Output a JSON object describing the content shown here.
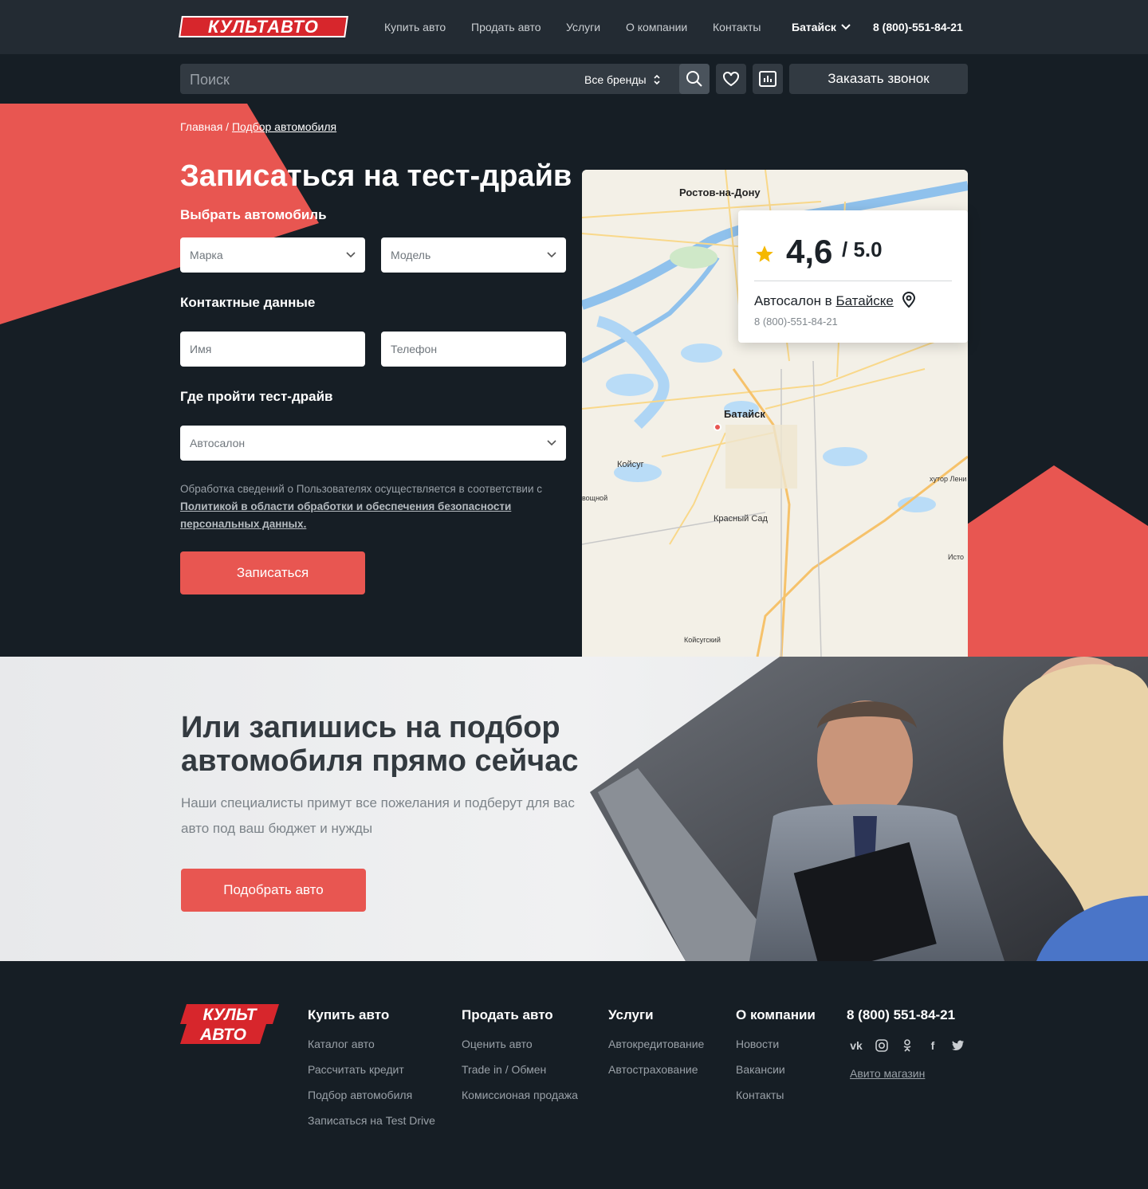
{
  "header": {
    "logo": "КУЛЬТАВТО",
    "nav": [
      "Купить авто",
      "Продать авто",
      "Услуги",
      "О компании",
      "Контакты"
    ],
    "city": "Батайск",
    "phone": "8 (800)-551-84-21"
  },
  "search": {
    "placeholder": "Поиск",
    "brands": "Все бренды",
    "callback": "Заказать звонок"
  },
  "hero": {
    "breadcrumb_home": "Главная",
    "breadcrumb_sep": " / ",
    "breadcrumb_current": "Подбор автомобиля",
    "title": "Записаться на тест-драйв",
    "choose_car": "Выбрать автомобиль",
    "brand_ph": "Марка",
    "model_ph": "Модель",
    "contacts": "Контактные данные",
    "name_ph": "Имя",
    "phone_ph": "Телефон",
    "where": "Где пройти тест-драйв",
    "salon_ph": "Автосалон",
    "legal_text": "Обработка сведений о Пользователях осуществляется  в соответствии с ",
    "legal_link": "Политикой в области обработки и обеспечения безопасности персональных данных.",
    "submit": "Записаться"
  },
  "map": {
    "labels": [
      "Ростов-на-Дону",
      "Батайск",
      "Койсуг",
      "Красный Сад",
      "Койсугский",
      "хутор Лени",
      "Исто",
      "вощной"
    ],
    "rating": "4,6",
    "rating_max": "/ 5.0",
    "place_text": "Автосалон в ",
    "place_city": "Батайске",
    "place_phone": "8 (800)-551-84-21"
  },
  "promo": {
    "title": "Или запишись на подбор автомобиля прямо сейчас",
    "text": "Наши специалисты примут все пожелания и подберут для вас авто под ваш бюджет и нужды",
    "button": "Подобрать авто"
  },
  "footer": {
    "logo_line1": "КУЛЬТ",
    "logo_line2": "АВТО",
    "columns": [
      {
        "title": "Купить авто",
        "links": [
          "Каталог авто",
          "Рассчитать кредит",
          "Подбор автомобиля",
          "Записаться на Test Drive"
        ]
      },
      {
        "title": "Продать авто",
        "links": [
          "Оценить авто",
          "Trade in / Обмен",
          "Комиссионая продажа"
        ]
      },
      {
        "title": "Услуги",
        "links": [
          "Автокредитование",
          "Автострахование"
        ]
      },
      {
        "title": "О компании",
        "links": [
          "Новости",
          "Вакансии",
          "Контакты"
        ]
      }
    ],
    "phone": "8 (800) 551-84-21",
    "avito": "Авито магазин"
  },
  "colors": {
    "accent": "#e85651",
    "dark": "#161e25",
    "header": "#232b33"
  }
}
